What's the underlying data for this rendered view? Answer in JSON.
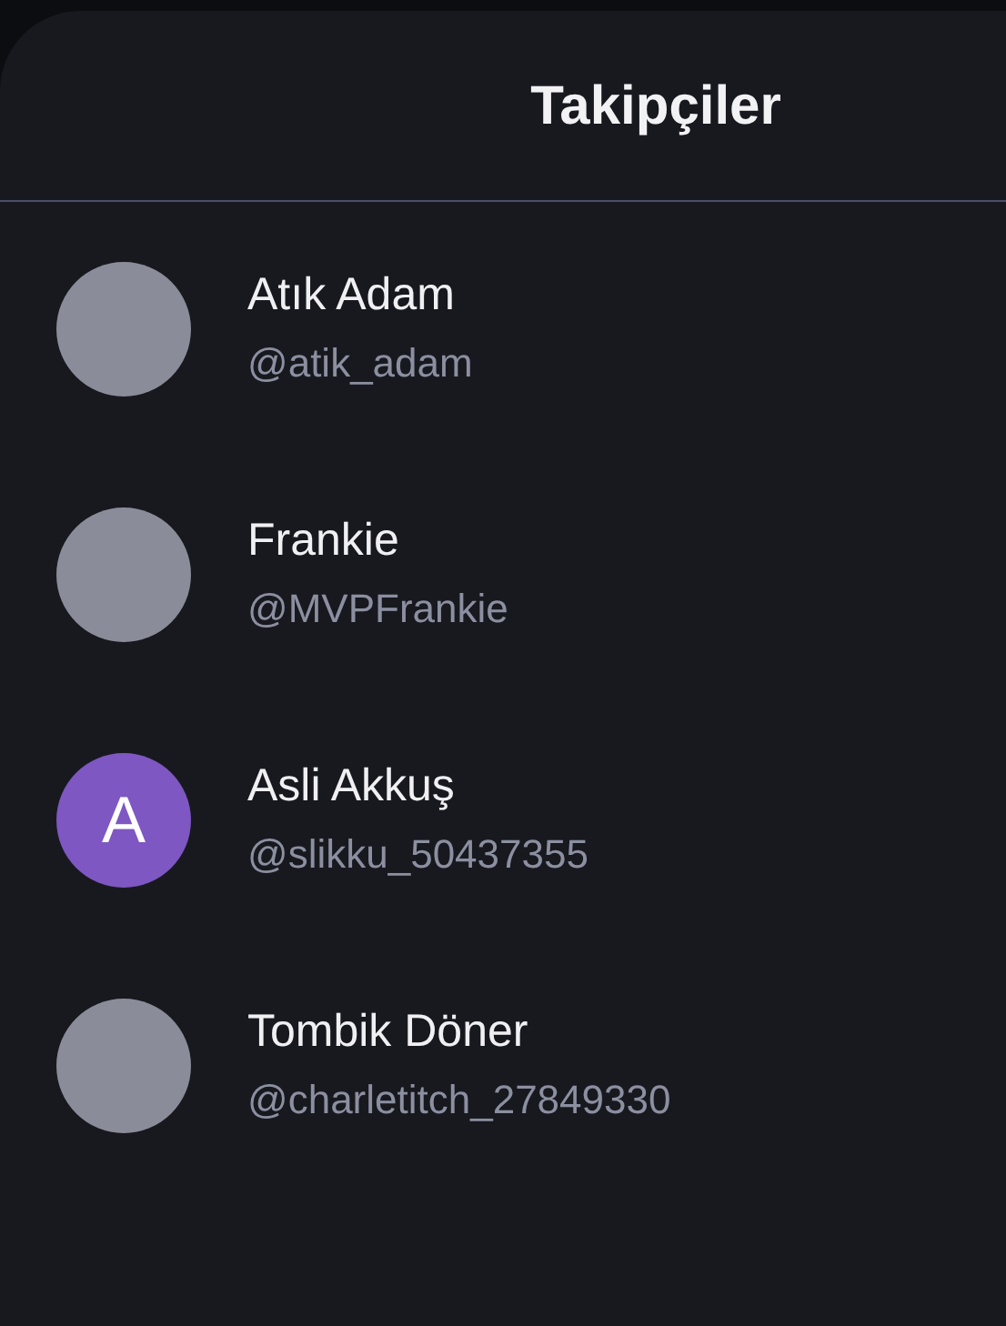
{
  "sheet": {
    "title": "Takipçiler"
  },
  "followers": [
    {
      "name": "Atık Adam",
      "handle": "@atik_adam",
      "avatar": {
        "kind": "photo"
      }
    },
    {
      "name": "Frankie",
      "handle": "@MVPFrankie",
      "avatar": {
        "kind": "photo"
      }
    },
    {
      "name": "Asli Akkuş",
      "handle": "@slikku_50437355",
      "avatar": {
        "kind": "letter",
        "initial": "A",
        "color": "#7e57c2"
      }
    },
    {
      "name": "Tombik Döner",
      "handle": "@charletitch_27849330",
      "avatar": {
        "kind": "photo"
      }
    }
  ]
}
